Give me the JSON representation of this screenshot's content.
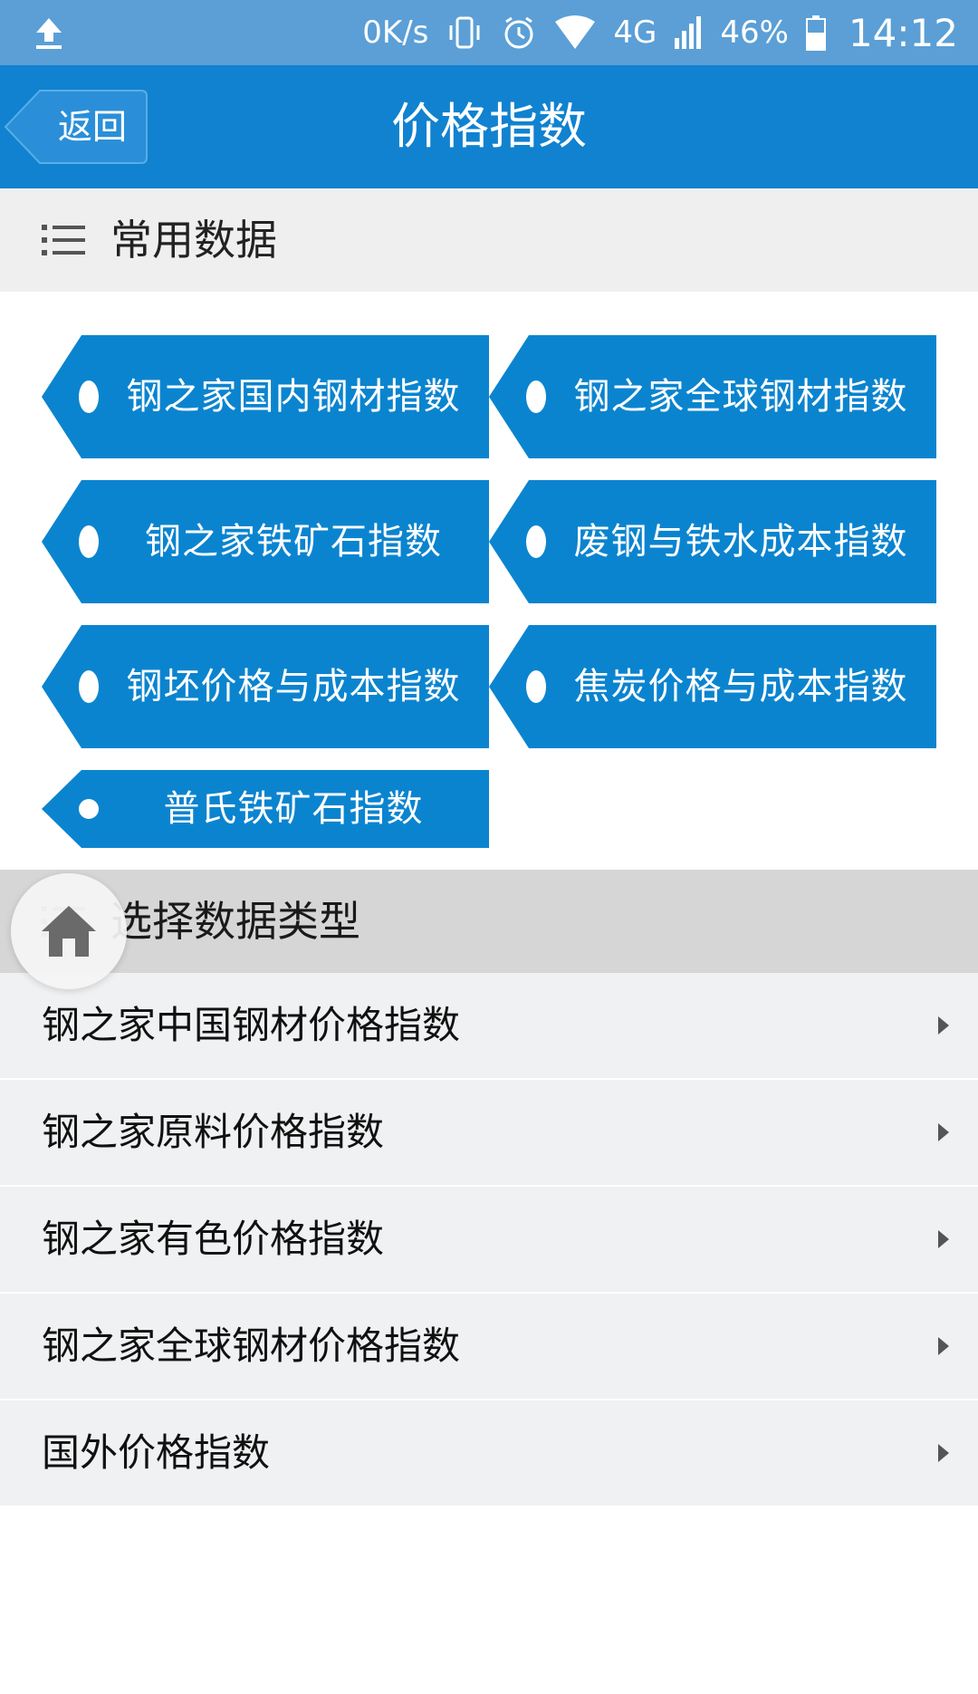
{
  "status_bar": {
    "speed": "0K/s",
    "network": "4G",
    "battery": "46%",
    "time": "14:12"
  },
  "header": {
    "back_label": "返回",
    "title": "价格指数"
  },
  "common_section": {
    "title": "常用数据",
    "tags": [
      {
        "label": "钢之家国内钢材指数"
      },
      {
        "label": "钢之家全球钢材指数"
      },
      {
        "label": "钢之家铁矿石指数"
      },
      {
        "label": "废钢与铁水成本指数"
      },
      {
        "label": "钢坯价格与成本指数"
      },
      {
        "label": "焦炭价格与成本指数"
      },
      {
        "label": "普氏铁矿石指数"
      }
    ]
  },
  "type_section": {
    "title": "选择数据类型",
    "items": [
      {
        "label": "钢之家中国钢材价格指数"
      },
      {
        "label": "钢之家原料价格指数"
      },
      {
        "label": "钢之家有色价格指数"
      },
      {
        "label": "钢之家全球钢材价格指数"
      },
      {
        "label": "国外价格指数"
      }
    ]
  },
  "colors": {
    "header": "#1082d0",
    "status_bar": "#5b9fd6",
    "tag": "#0b84cf"
  }
}
